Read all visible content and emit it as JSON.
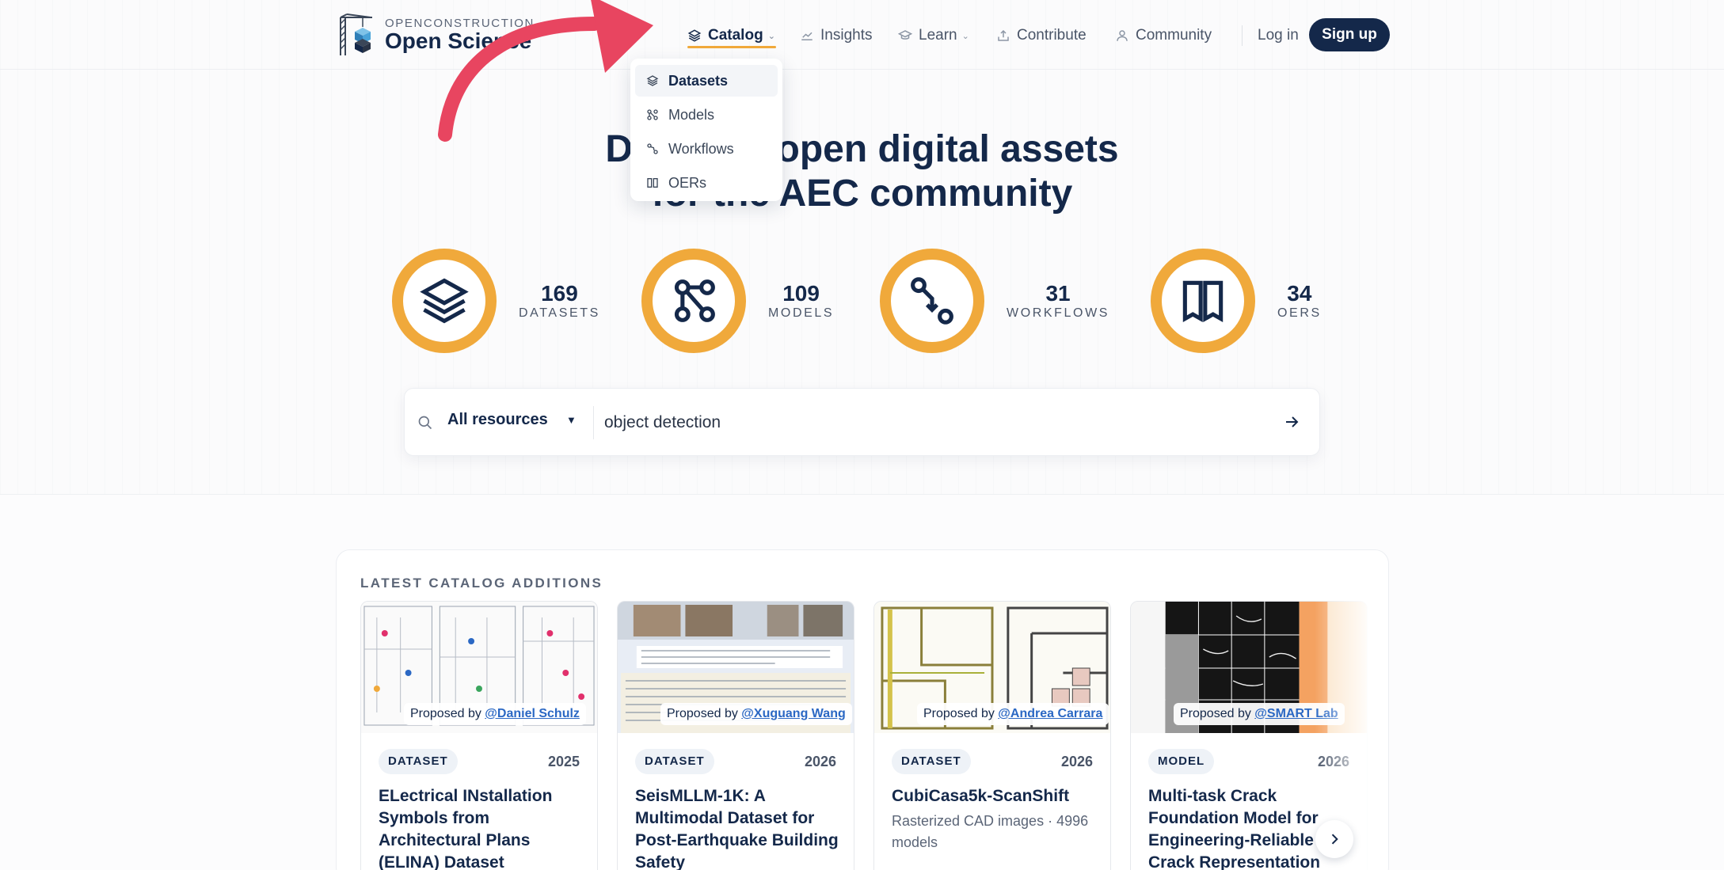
{
  "brand": {
    "small": "OPENCONSTRUCTION",
    "name": "Open Science"
  },
  "nav": {
    "items": [
      {
        "label": "Catalog",
        "icon": "layers-icon"
      },
      {
        "label": "Insights",
        "icon": "chart-icon"
      },
      {
        "label": "Learn",
        "icon": "graduation-cap-icon"
      },
      {
        "label": "Contribute",
        "icon": "upload-icon"
      },
      {
        "label": "Community",
        "icon": "user-icon"
      }
    ],
    "login": "Log in",
    "signup": "Sign up"
  },
  "dropdown": {
    "items": [
      "Datasets",
      "Models",
      "Workflows",
      "OERs"
    ]
  },
  "hero": {
    "line1": "Discover open digital assets",
    "line2": "for the AEC community"
  },
  "stats": [
    {
      "value": "169",
      "label": "DATASETS"
    },
    {
      "value": "109",
      "label": "MODELS"
    },
    {
      "value": "31",
      "label": "WORKFLOWS"
    },
    {
      "value": "34",
      "label": "OERS"
    }
  ],
  "search": {
    "scope": "All resources",
    "query": "object detection"
  },
  "latest": {
    "title": "LATEST CATALOG ADDITIONS",
    "proposed_prefix": "Proposed by",
    "cards": [
      {
        "by": "@Daniel Schulz",
        "type": "DATASET",
        "year": "2025",
        "title": "ELectrical INstallation Symbols from Architectural Plans (ELINA) Dataset",
        "desc": ""
      },
      {
        "by": "@Xuguang Wang",
        "type": "DATASET",
        "year": "2026",
        "title": "SeisMLLM-1K: A Multimodal Dataset for Post-Earthquake Building Safety",
        "desc": ""
      },
      {
        "by": "@Andrea Carrara",
        "type": "DATASET",
        "year": "2026",
        "title": "CubiCasa5k-ScanShift",
        "desc": "Rasterized CAD images · 4996 models"
      },
      {
        "by": "@SMART Lab",
        "type": "MODEL",
        "year": "2026",
        "title": "Multi-task Crack Foundation Model for Engineering-Reliable Crack Representation",
        "desc": ""
      }
    ]
  },
  "colors": {
    "accent": "#f0a93b",
    "navy": "#14284a",
    "arrow": "#e84560",
    "link": "#2b68c4"
  }
}
